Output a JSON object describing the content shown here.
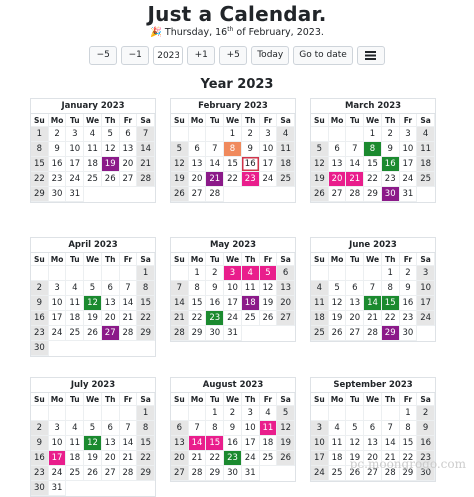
{
  "header": {
    "title": "Just a Calendar.",
    "party_emoji": "🎉",
    "date_prefix": "Thursday, 16",
    "date_sup": "th",
    "date_suffix": " of February, 2023."
  },
  "toolbar": {
    "minus5": "−5",
    "minus1": "−1",
    "year_value": "2023",
    "plus1": "+1",
    "plus5": "+5",
    "today": "Today",
    "goto": "Go to date"
  },
  "year_heading": "Year 2023",
  "weekdays": [
    "Su",
    "Mo",
    "Tu",
    "We",
    "Th",
    "Fr",
    "Sa"
  ],
  "colors": {
    "pink": "#e91e8c",
    "purple": "#8b1a89",
    "green": "#1b8a2f",
    "orange": "#f08a5d",
    "today_border": "#d0344b"
  },
  "months": [
    {
      "name": "January 2023",
      "start": 0,
      "days": 31,
      "marks": {
        "1": "we",
        "7": "we",
        "8": "we",
        "14": "we",
        "15": "we",
        "21": "we",
        "22": "we",
        "28": "we",
        "29": "we",
        "19": "hol-purple"
      }
    },
    {
      "name": "February 2023",
      "start": 3,
      "days": 28,
      "marks": {
        "4": "we",
        "5": "we",
        "11": "we",
        "12": "we",
        "18": "we",
        "19": "we",
        "25": "we",
        "26": "we",
        "8": "hol-orange",
        "16": "today",
        "21": "hol-purple",
        "23": "hol-pink"
      }
    },
    {
      "name": "March 2023",
      "start": 3,
      "days": 31,
      "marks": {
        "4": "we",
        "5": "we",
        "11": "we",
        "12": "we",
        "18": "we",
        "19": "we",
        "25": "we",
        "26": "we",
        "8": "hol-green",
        "16": "hol-green",
        "20": "hol-pink",
        "21": "hol-pink",
        "30": "hol-purple"
      }
    },
    {
      "name": "April 2023",
      "start": 6,
      "days": 30,
      "marks": {
        "1": "we",
        "2": "we",
        "8": "we",
        "9": "we",
        "15": "we",
        "16": "we",
        "22": "we",
        "23": "we",
        "29": "we",
        "30": "we",
        "12": "hol-green",
        "27": "hol-purple"
      }
    },
    {
      "name": "May 2023",
      "start": 1,
      "days": 31,
      "marks": {
        "6": "we",
        "7": "we",
        "13": "we",
        "14": "we",
        "20": "we",
        "21": "we",
        "27": "we",
        "28": "we",
        "3": "hol-pink",
        "4": "hol-pink",
        "5": "hol-pink",
        "18": "hol-purple",
        "23": "hol-green"
      }
    },
    {
      "name": "June 2023",
      "start": 4,
      "days": 30,
      "marks": {
        "3": "we",
        "4": "we",
        "10": "we",
        "11": "we",
        "17": "we",
        "18": "we",
        "24": "we",
        "25": "we",
        "14": "hol-green",
        "15": "hol-green",
        "29": "hol-purple"
      }
    },
    {
      "name": "July 2023",
      "start": 6,
      "days": 31,
      "marks": {
        "1": "we",
        "2": "we",
        "8": "we",
        "9": "we",
        "15": "we",
        "16": "we",
        "22": "we",
        "23": "we",
        "29": "we",
        "30": "we",
        "12": "hol-green",
        "17": "hol-pink"
      }
    },
    {
      "name": "August 2023",
      "start": 2,
      "days": 31,
      "marks": {
        "5": "we",
        "6": "we",
        "12": "we",
        "13": "we",
        "19": "we",
        "20": "we",
        "26": "we",
        "27": "we",
        "11": "hol-pink",
        "14": "hol-pink",
        "15": "hol-pink",
        "23": "hol-green"
      }
    },
    {
      "name": "September 2023",
      "start": 5,
      "days": 30,
      "marks": {
        "2": "we",
        "3": "we",
        "9": "we",
        "10": "we",
        "16": "we",
        "17": "we",
        "23": "we",
        "24": "we",
        "30": "we"
      }
    }
  ],
  "watermark": "pc.moongrogo.com"
}
